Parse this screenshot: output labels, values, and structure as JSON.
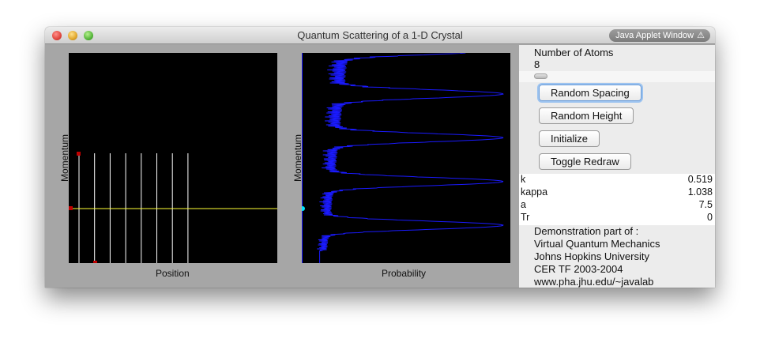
{
  "window": {
    "title": "Quantum Scattering of a 1-D Crystal",
    "badge": "Java Applet Window"
  },
  "left_plot": {
    "xlabel": "Position",
    "ylabel": "Momentum"
  },
  "right_plot": {
    "xlabel": "Probability",
    "ylabel": "Momentum"
  },
  "controls": {
    "atoms_label": "Number of Atoms",
    "atoms_value": "8",
    "buttons": [
      "Random Spacing",
      "Random Height",
      "Initialize",
      "Toggle Redraw"
    ]
  },
  "params": [
    {
      "name": "k",
      "value": "0.519"
    },
    {
      "name": "kappa",
      "value": "1.038"
    },
    {
      "name": "a",
      "value": "7.5"
    },
    {
      "name": "Tr",
      "value": "0"
    }
  ],
  "demo": [
    "Demonstration part of :",
    "Virtual Quantum Mechanics",
    "Johns Hopkins University",
    "CER TF 2003-2004",
    "www.pha.jhu.edu/~javalab"
  ],
  "colors": {
    "plot_bg": "#000000",
    "atom_lines": "#ffffff",
    "energy_line": "#ffff33",
    "markers": "#c00000",
    "probability_curve": "#1a1aff",
    "probe_marker": "#00e5ff"
  },
  "icons": {
    "badge_icon": "warning-triangle-icon"
  }
}
